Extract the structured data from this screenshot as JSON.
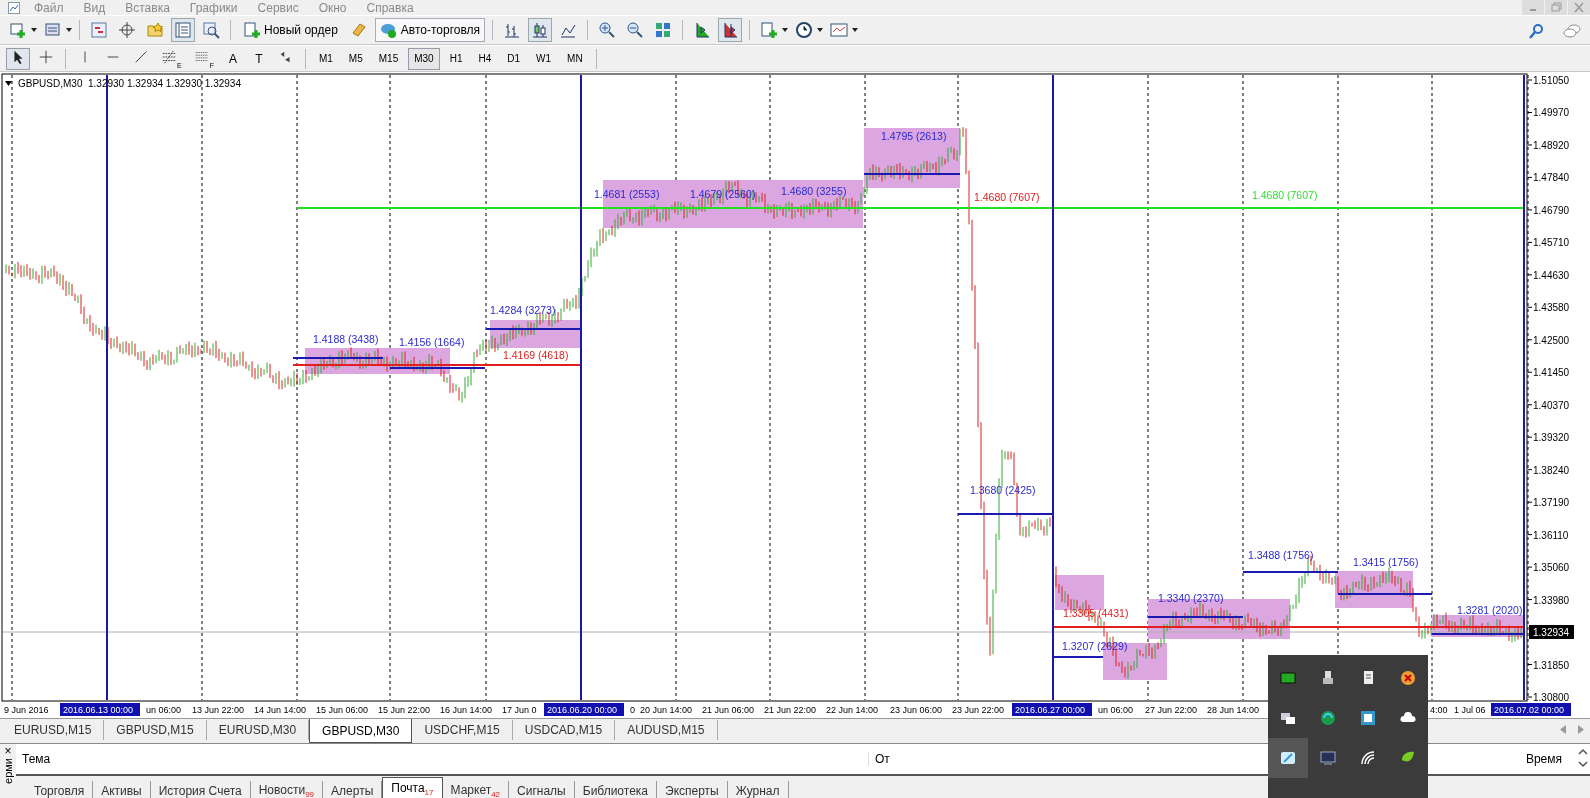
{
  "menu": [
    "Файл",
    "Вид",
    "Вставка",
    "Графики",
    "Сервис",
    "Окно",
    "Справка"
  ],
  "toolbar": {
    "new_order": "Новый ордер",
    "autotrading": {
      "label": "Авто-торговля",
      "on": true
    },
    "chart_modes": [
      {
        "kind": "bars",
        "selected": false
      },
      {
        "kind": "candles",
        "selected": true
      },
      {
        "kind": "line",
        "selected": false
      }
    ]
  },
  "draw_tools": [
    {
      "kind": "cursor",
      "selected": true
    },
    {
      "kind": "crosshair",
      "selected": false
    },
    {
      "kind": "vline",
      "selected": false
    },
    {
      "kind": "hline",
      "selected": false
    },
    {
      "kind": "trendline",
      "selected": false
    },
    {
      "kind": "fibo",
      "mark": "E",
      "selected": false
    },
    {
      "kind": "channel",
      "mark": "F",
      "selected": false
    },
    {
      "kind": "text",
      "label": "A",
      "selected": false
    },
    {
      "kind": "label",
      "label": "T",
      "selected": false
    },
    {
      "kind": "arrows",
      "selected": false
    }
  ],
  "timeframes": [
    {
      "label": "M1",
      "selected": false
    },
    {
      "label": "M5",
      "selected": false
    },
    {
      "label": "M15",
      "selected": false
    },
    {
      "label": "M30",
      "selected": true
    },
    {
      "label": "H1",
      "selected": false
    },
    {
      "label": "H4",
      "selected": false
    },
    {
      "label": "D1",
      "selected": false
    },
    {
      "label": "W1",
      "selected": false
    },
    {
      "label": "MN",
      "selected": false
    }
  ],
  "chart": {
    "symbol_info": "GBPUSD,M30  1.32930 1.32934 1.32930 1.32934",
    "price_ticks": [
      "1.51050",
      "1.49970",
      "1.48920",
      "1.47840",
      "1.46790",
      "1.45710",
      "1.44630",
      "1.43580",
      "1.42500",
      "1.41450",
      "1.40370",
      "1.39320",
      "1.38240",
      "1.37190",
      "1.36110",
      "1.35060",
      "1.33980",
      "1.31850",
      "1.30800"
    ],
    "current_price": "1.32934",
    "time_labels": [
      {
        "text": "9 Jun 2016",
        "highlighted": false
      },
      {
        "text": "2016.06.13 00:00",
        "highlighted": true
      },
      {
        "text": "un 06:00",
        "highlighted": false
      },
      {
        "text": "13 Jun 22:00",
        "highlighted": false
      },
      {
        "text": "14 Jun 14:00",
        "highlighted": false
      },
      {
        "text": "15 Jun 06:00",
        "highlighted": false
      },
      {
        "text": "15 Jun 22:00",
        "highlighted": false
      },
      {
        "text": "16 Jun 14:00",
        "highlighted": false
      },
      {
        "text": "17 Jun 0",
        "highlighted": false
      },
      {
        "text": "2016.06.20 00:00",
        "highlighted": true
      },
      {
        "text": "0",
        "highlighted": false
      },
      {
        "text": "20 Jun 14:00",
        "highlighted": false
      },
      {
        "text": "21 Jun 06:00",
        "highlighted": false
      },
      {
        "text": "21 Jun 22:00",
        "highlighted": false
      },
      {
        "text": "22 Jun 14:00",
        "highlighted": false
      },
      {
        "text": "23 Jun 06:00",
        "highlighted": false
      },
      {
        "text": "23 Jun 22:00",
        "highlighted": false
      },
      {
        "text": "2016.06.27 00:00",
        "highlighted": true
      },
      {
        "text": "un 06:00",
        "highlighted": false
      },
      {
        "text": "27 Jun 22:00",
        "highlighted": false
      },
      {
        "text": "28 Jun 14:00",
        "highlighted": false
      },
      {
        "text": "4:00",
        "highlighted": false
      },
      {
        "text": "1 Jul 06",
        "highlighted": false
      },
      {
        "text": "2016.07.02 00:00",
        "highlighted": true
      }
    ],
    "annotations": [
      {
        "text": "1.4188 (3438)",
        "color": "#2a2ad0"
      },
      {
        "text": "1.4156 (1664)",
        "color": "#2a2ad0"
      },
      {
        "text": "1.4169 (4618)",
        "color": "#e02020"
      },
      {
        "text": "1.4284 (3273)",
        "color": "#2a2ad0"
      },
      {
        "text": "1.4681 (2553)",
        "color": "#2a2ad0"
      },
      {
        "text": "1.4679 (2560)",
        "color": "#2a2ad0"
      },
      {
        "text": "1.4680 (3255)",
        "color": "#2a2ad0"
      },
      {
        "text": "1.4795 (2613)",
        "color": "#2a2ad0"
      },
      {
        "text": "1.4680 (7607)",
        "color": "#e02020"
      },
      {
        "text": "1.4680 (7607)",
        "color": "#33dd33"
      },
      {
        "text": "1.3680 (2425)",
        "color": "#2a2ad0"
      },
      {
        "text": "1.3305 (4431)",
        "color": "#e02020"
      },
      {
        "text": "1.3207 (2629)",
        "color": "#2a2ad0"
      },
      {
        "text": "1.3340 (2370)",
        "color": "#2a2ad0"
      },
      {
        "text": "1.3488 (1756)",
        "color": "#2a2ad0"
      },
      {
        "text": "1.3415 (1756)",
        "color": "#2a2ad0"
      },
      {
        "text": "1.3281 (2020)",
        "color": "#2a2ad0"
      }
    ]
  },
  "chart_tabs": [
    {
      "label": "EURUSD,M15",
      "selected": false
    },
    {
      "label": "GBPUSD,M15",
      "selected": false
    },
    {
      "label": "EURUSD,M30",
      "selected": false
    },
    {
      "label": "GBPUSD,M30",
      "selected": true
    },
    {
      "label": "USDCHF,M15",
      "selected": false
    },
    {
      "label": "USDCAD,M15",
      "selected": false
    },
    {
      "label": "AUDUSD,M15",
      "selected": false
    }
  ],
  "terminal": {
    "close": "×",
    "side_label": "ерми",
    "columns": [
      "Тема",
      "От",
      "Время"
    ],
    "tabs": [
      {
        "label": "Торговля",
        "selected": false
      },
      {
        "label": "Активы",
        "selected": false
      },
      {
        "label": "История Счета",
        "selected": false
      },
      {
        "label": "Новости",
        "badge": "99",
        "selected": false
      },
      {
        "label": "Алерты",
        "selected": false
      },
      {
        "label": "Почта",
        "badge": "17",
        "selected": true
      },
      {
        "label": "Маркет",
        "badge": "42",
        "selected": false
      },
      {
        "label": "Сигналы",
        "selected": false
      },
      {
        "label": "Библиотека",
        "selected": false
      },
      {
        "label": "Эксперты",
        "selected": false
      },
      {
        "label": "Журнал",
        "selected": false
      }
    ]
  }
}
